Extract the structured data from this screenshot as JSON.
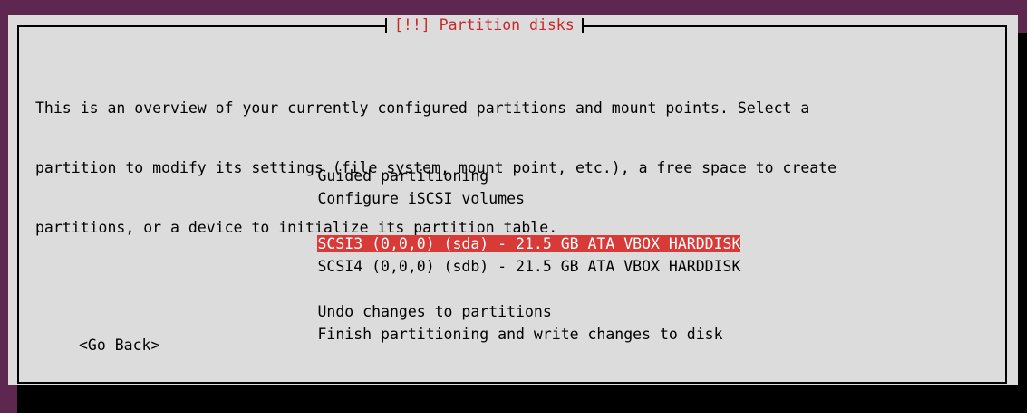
{
  "dialog": {
    "title": "[!!] Partition disks",
    "intro_lines": [
      "This is an overview of your currently configured partitions and mount points. Select a",
      "partition to modify its settings (file system, mount point, etc.), a free space to create",
      "partitions, or a device to initialize its partition table."
    ],
    "menu": {
      "group1": [
        {
          "label": "Guided partitioning"
        },
        {
          "label": "Configure iSCSI volumes"
        }
      ],
      "group2": [
        {
          "label": "SCSI3 (0,0,0) (sda) - 21.5 GB ATA VBOX HARDDISK",
          "selected": true
        },
        {
          "label": "SCSI4 (0,0,0) (sdb) - 21.5 GB ATA VBOX HARDDISK",
          "selected": false
        }
      ],
      "group3": [
        {
          "label": "Undo changes to partitions"
        },
        {
          "label": "Finish partitioning and write changes to disk"
        }
      ]
    },
    "go_back_label": "<Go Back>"
  },
  "colors": {
    "background_purple": "#5e2750",
    "dialog_gray": "#dcdcdc",
    "title_red": "#c8282a",
    "selection_red": "#d73a37",
    "shadow": "#000000"
  }
}
